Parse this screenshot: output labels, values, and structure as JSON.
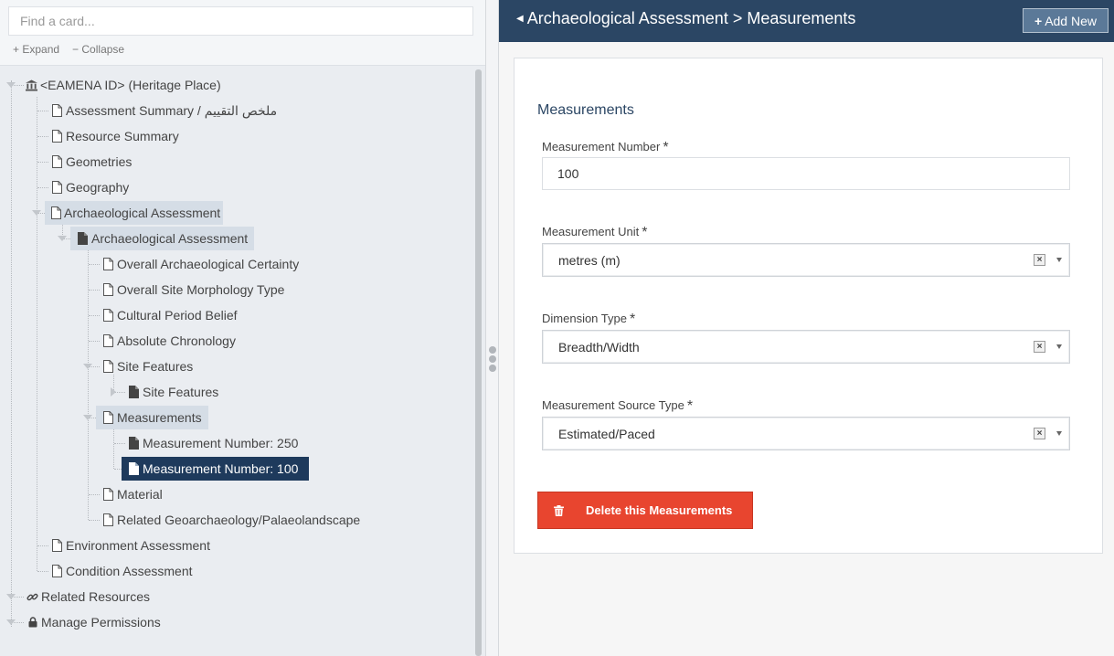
{
  "search": {
    "placeholder": "Find a card..."
  },
  "tree_controls": {
    "expand": "Expand",
    "collapse": "Collapse"
  },
  "tree": {
    "root": "<EAMENA ID> (Heritage Place)",
    "assessment_summary": "Assessment Summary / ملخص التقييم",
    "resource_summary": "Resource Summary",
    "geometries": "Geometries",
    "geography": "Geography",
    "arch_assessment": "Archaeological Assessment",
    "arch_assessment_child": "Archaeological Assessment",
    "overall_certainty": "Overall Archaeological Certainty",
    "overall_morphology": "Overall Site Morphology Type",
    "cultural_period": "Cultural Period Belief",
    "absolute_chronology": "Absolute Chronology",
    "site_features": "Site Features",
    "site_features_child": "Site Features",
    "measurements": "Measurements",
    "measurement_250": "Measurement Number: 250",
    "measurement_100": "Measurement Number: 100",
    "material": "Material",
    "related_geoarch": "Related Geoarchaeology/Palaeolandscape",
    "environment_assessment": "Environment Assessment",
    "condition_assessment": "Condition Assessment",
    "related_resources": "Related Resources",
    "manage_permissions": "Manage Permissions"
  },
  "header": {
    "breadcrumb": "Archaeological Assessment > Measurements",
    "add_new": "Add New"
  },
  "form": {
    "title": "Measurements",
    "fields": [
      {
        "label": "Measurement Number",
        "required": "*",
        "value": "100"
      },
      {
        "label": "Measurement Unit",
        "required": "*",
        "value": "metres (m)"
      },
      {
        "label": "Dimension Type",
        "required": "*",
        "value": "Breadth/Width"
      },
      {
        "label": "Measurement Source Type",
        "required": "*",
        "value": "Estimated/Paced"
      }
    ],
    "delete_label": "Delete this Measurements"
  },
  "icons": {
    "root": "bank-icon",
    "card": "file-outline-icon",
    "card_filled": "file-filled-icon",
    "link": "link-icon",
    "lock": "lock-icon",
    "trash": "trash-icon"
  },
  "colors": {
    "header_bg": "#2b4664",
    "selected_node": "#1e3a5c",
    "highlight_node": "#d5dde6",
    "delete_button": "#e8452f"
  }
}
